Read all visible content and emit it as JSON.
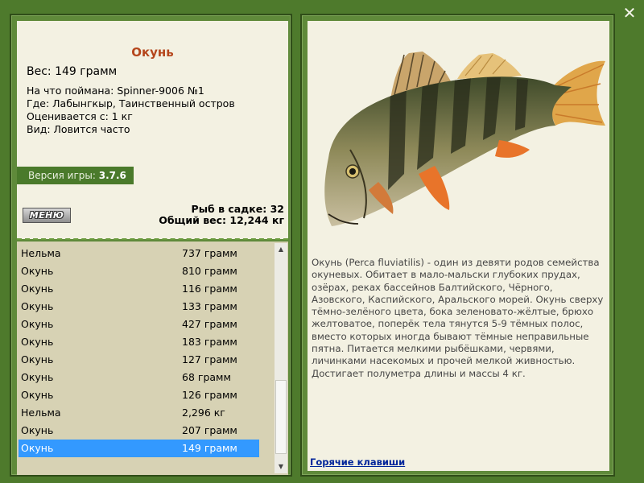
{
  "window": {
    "close_icon": "close-x-icon"
  },
  "fish": {
    "title": "Окунь",
    "weight_line": "Вес: 149 грамм",
    "details": [
      "На что поймана: Spinner-9006 №1",
      "Где: Лабынгкыр, Таинственный остров",
      "Оценивается с: 1 кг",
      "Вид: Ловится часто"
    ]
  },
  "version": {
    "label": "Версия игры:",
    "value": "3.7.6"
  },
  "menu_button": {
    "label": "МЕНЮ"
  },
  "stats": {
    "fish_in_keepnet": "Рыб в садке: 32",
    "total_weight": "Общий вес: 12,244 кг"
  },
  "catch_list": {
    "selected_index": 11,
    "rows": [
      {
        "name": "Нельма",
        "weight": "737 грамм"
      },
      {
        "name": "Окунь",
        "weight": "810 грамм"
      },
      {
        "name": "Окунь",
        "weight": "116 грамм"
      },
      {
        "name": "Окунь",
        "weight": "133 грамм"
      },
      {
        "name": "Окунь",
        "weight": "427 грамм"
      },
      {
        "name": "Окунь",
        "weight": "183 грамм"
      },
      {
        "name": "Окунь",
        "weight": "127 грамм"
      },
      {
        "name": "Окунь",
        "weight": "68 грамм"
      },
      {
        "name": "Окунь",
        "weight": "126 грамм"
      },
      {
        "name": "Нельма",
        "weight": "2,296 кг"
      },
      {
        "name": "Окунь",
        "weight": "207 грамм"
      },
      {
        "name": "Окунь",
        "weight": "149 грамм"
      }
    ]
  },
  "description": "Окунь (Perca fluviatilis) - один из девяти родов семейства окуневых. Обитает в мало-мальски глубоких прудах, озёрах, реках бассейнов Балтийского, Чёрного, Азовского, Каспийского, Аральского морей. Окунь сверху тёмно-зелёного цвета, бока зеленовато-жёлтые, брюхо желтоватое, поперёк тела тянутся 5-9 тёмных полос, вместо которых иногда бывают тёмные неправильные пятна. Питается мелкими рыбёшками, червями, личинками насекомых и прочей мелкой живностью. Достигает полуметра длины и массы 4 кг.",
  "hotkeys_link": "Горячие клавиши",
  "colors": {
    "background": "#4e7a2c",
    "panel_bg": "#f3f1e2",
    "list_bg": "#d7d2b4",
    "title": "#b5461c",
    "selection": "#3399ff",
    "link": "#00259a"
  }
}
